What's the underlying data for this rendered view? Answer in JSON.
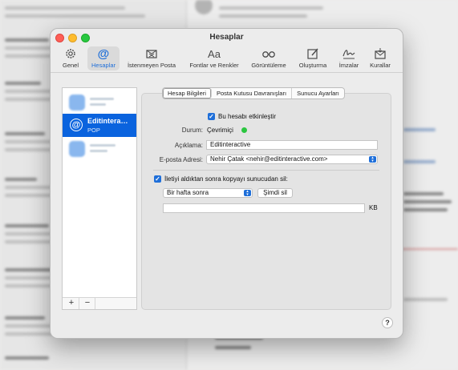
{
  "window": {
    "title": "Hesaplar"
  },
  "toolbar": [
    {
      "label": "Genel",
      "icon": "gear-icon"
    },
    {
      "label": "Hesaplar",
      "icon": "at-icon"
    },
    {
      "label": "İstenmeyen Posta",
      "icon": "junk-mail-icon"
    },
    {
      "label": "Fontlar ve Renkler",
      "icon": "font-icon"
    },
    {
      "label": "Görüntüleme",
      "icon": "glasses-icon"
    },
    {
      "label": "Oluşturma",
      "icon": "compose-icon"
    },
    {
      "label": "İmzalar",
      "icon": "signature-icon"
    },
    {
      "label": "Kurallar",
      "icon": "rules-icon"
    }
  ],
  "accounts": {
    "selected": {
      "name": "Editintera…",
      "type": "POP",
      "icon": "at-icon"
    },
    "add_label": "+",
    "remove_label": "−"
  },
  "tabs": [
    "Hesap Bilgileri",
    "Posta Kutusu Davranışları",
    "Sunucu Ayarları"
  ],
  "account_info": {
    "enable_label": "Bu hesabı etkinleştir",
    "status_label": "Durum:",
    "status_value": "Çevrimiçi",
    "description_label": "Açıklama:",
    "description_value": "Editinteractive",
    "email_label": "E-posta Adresi:",
    "email_value": "Nehir Çatak <nehir@editinteractive.com>",
    "delete_copy_label": "İletiyi aldıktan sonra kopyayı sunucudan sil:",
    "delete_after_value": "Bir hafta sonra",
    "delete_now_label": "Şimdi sil",
    "size_unit": "KB"
  },
  "help_label": "?",
  "colors": {
    "accent": "#1f6fd9",
    "selection": "#0a63de",
    "status_online": "#2bc640"
  }
}
